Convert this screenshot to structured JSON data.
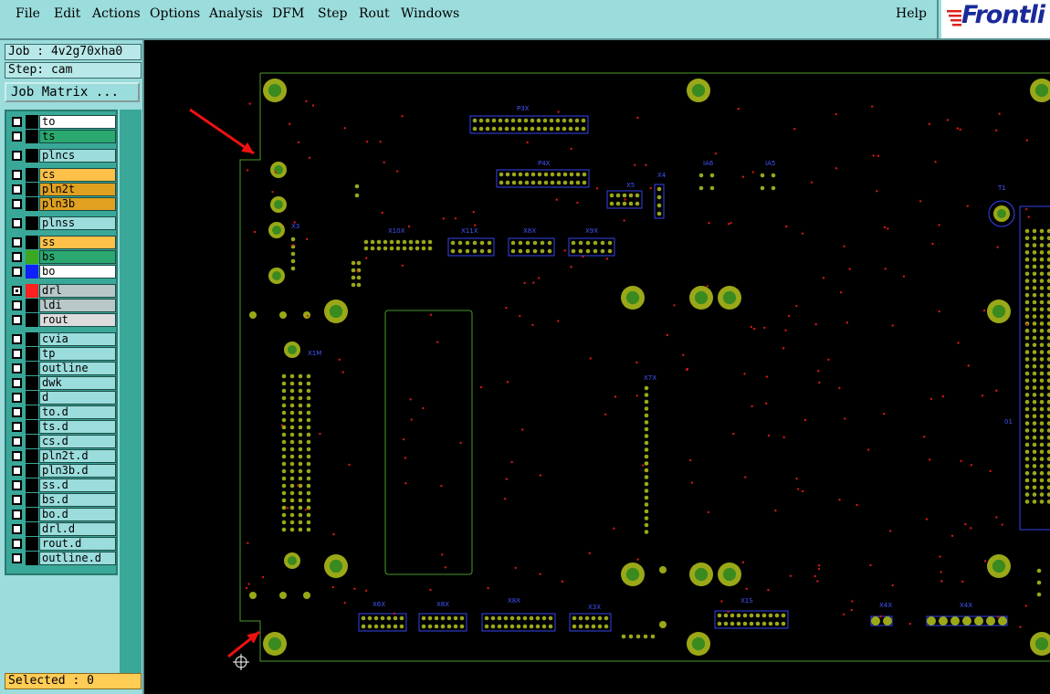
{
  "menu": {
    "items": [
      "File",
      "Edit",
      "Actions",
      "Options",
      "Analysis",
      "DFM",
      "Step",
      "Rout",
      "Windows"
    ],
    "help": "Help",
    "logo_text": "Frontli"
  },
  "panel": {
    "job": "Job : 4v2g70xha0",
    "step": "Step: cam",
    "job_matrix": "Job Matrix ...",
    "selected": "Selected : 0"
  },
  "layers": [
    {
      "name": "to",
      "color": "#ffffff",
      "swatch": "#000000"
    },
    {
      "name": "ts",
      "color": "#2aa870",
      "swatch": "#000000"
    },
    {
      "name": "plncs",
      "color": "#9bdcdc",
      "swatch": "#000000"
    },
    {
      "name": "cs",
      "color": "#ffc04a",
      "swatch": "#000000"
    },
    {
      "name": "pln2t",
      "color": "#e0a020",
      "swatch": "#000000"
    },
    {
      "name": "pln3b",
      "color": "#e0a020",
      "swatch": "#000000"
    },
    {
      "name": "plnss",
      "color": "#9bdcdc",
      "swatch": "#000000"
    },
    {
      "name": "ss",
      "color": "#ffc04a",
      "swatch": "#000000"
    },
    {
      "name": "bs",
      "color": "#2aa870",
      "swatch": "#3aa820"
    },
    {
      "name": "bo",
      "color": "#ffffff",
      "swatch": "#1020ff"
    },
    {
      "name": "drl",
      "color": "#b8c8c8",
      "swatch": "#ff2020"
    },
    {
      "name": "ldi",
      "color": "#b8c8c8",
      "swatch": "#000000"
    },
    {
      "name": "rout",
      "color": "#dcdcdc",
      "swatch": "#000000"
    },
    {
      "name": "cvia",
      "color": "#9bdcdc",
      "swatch": "#000000"
    },
    {
      "name": "tp",
      "color": "#9bdcdc",
      "swatch": "#000000"
    },
    {
      "name": "outline",
      "color": "#9bdcdc",
      "swatch": "#000000"
    },
    {
      "name": "dwk",
      "color": "#9bdcdc",
      "swatch": "#000000"
    },
    {
      "name": "d",
      "color": "#9bdcdc",
      "swatch": "#000000"
    },
    {
      "name": "to.d",
      "color": "#9bdcdc",
      "swatch": "#000000"
    },
    {
      "name": "ts.d",
      "color": "#9bdcdc",
      "swatch": "#000000"
    },
    {
      "name": "cs.d",
      "color": "#9bdcdc",
      "swatch": "#000000"
    },
    {
      "name": "pln2t.d",
      "color": "#9bdcdc",
      "swatch": "#000000"
    },
    {
      "name": "pln3b.d",
      "color": "#9bdcdc",
      "swatch": "#000000"
    },
    {
      "name": "ss.d",
      "color": "#9bdcdc",
      "swatch": "#000000"
    },
    {
      "name": "bs.d",
      "color": "#9bdcdc",
      "swatch": "#000000"
    },
    {
      "name": "bo.d",
      "color": "#9bdcdc",
      "swatch": "#000000"
    },
    {
      "name": "drl.d",
      "color": "#9bdcdc",
      "swatch": "#000000"
    },
    {
      "name": "rout.d",
      "color": "#9bdcdc",
      "swatch": "#000000"
    },
    {
      "name": "outline.d",
      "color": "#9bdcdc",
      "swatch": "#000000"
    }
  ],
  "colors": {
    "board_outline": "#4a9a2a",
    "pad": "#9aa818",
    "pad_hole": "#3a8a20",
    "drill": "#d81818",
    "silkscreen": "#3344ee",
    "arrow": "#ee1111"
  },
  "icons": [
    "red-arrow-icon",
    "crosshair-icon"
  ]
}
